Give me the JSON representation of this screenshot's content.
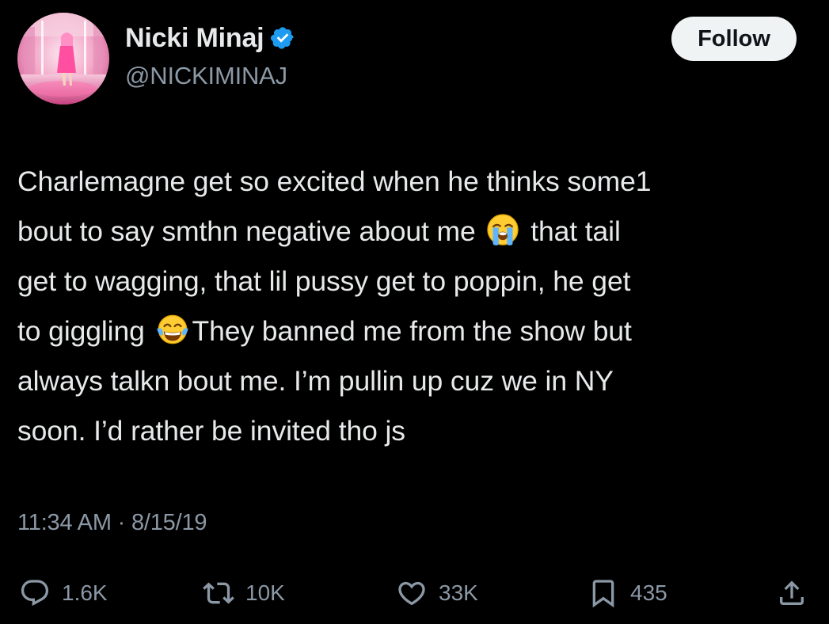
{
  "author": {
    "display_name": "Nicki Minaj",
    "handle": "@NICKIMINAJ",
    "verified": true,
    "avatar_icon": "profile-photo-pink"
  },
  "follow_button": {
    "label": "Follow"
  },
  "tweet": {
    "lines": [
      {
        "parts": [
          "Charlemagne get so excited when he thinks some1"
        ]
      },
      {
        "parts": [
          "bout to say smthn negative about me",
          "that tail"
        ]
      },
      {
        "parts": [
          "get to wagging, that lil pussy get to poppin, he get"
        ]
      },
      {
        "parts": [
          "to giggling",
          "They banned me from the show but"
        ]
      },
      {
        "parts": [
          "always talkn bout me. I’m pullin up cuz we in NY"
        ]
      },
      {
        "parts": [
          "soon. I’d rather be invited tho js"
        ]
      }
    ],
    "emojis": [
      "loudly-crying-face-emoji",
      "face-with-tears-of-joy-emoji"
    ],
    "time": "11:34 AM",
    "separator": "·",
    "date": "8/15/19"
  },
  "actions": {
    "replies": "1.6K",
    "retweets": "10K",
    "likes": "33K",
    "bookmarks": "435"
  },
  "colors": {
    "background": "#000000",
    "text_primary": "#e7e9ea",
    "text_secondary": "#8b98a5",
    "verified_badge": "#1d9bf0",
    "follow_button_bg": "#eff3f4"
  }
}
